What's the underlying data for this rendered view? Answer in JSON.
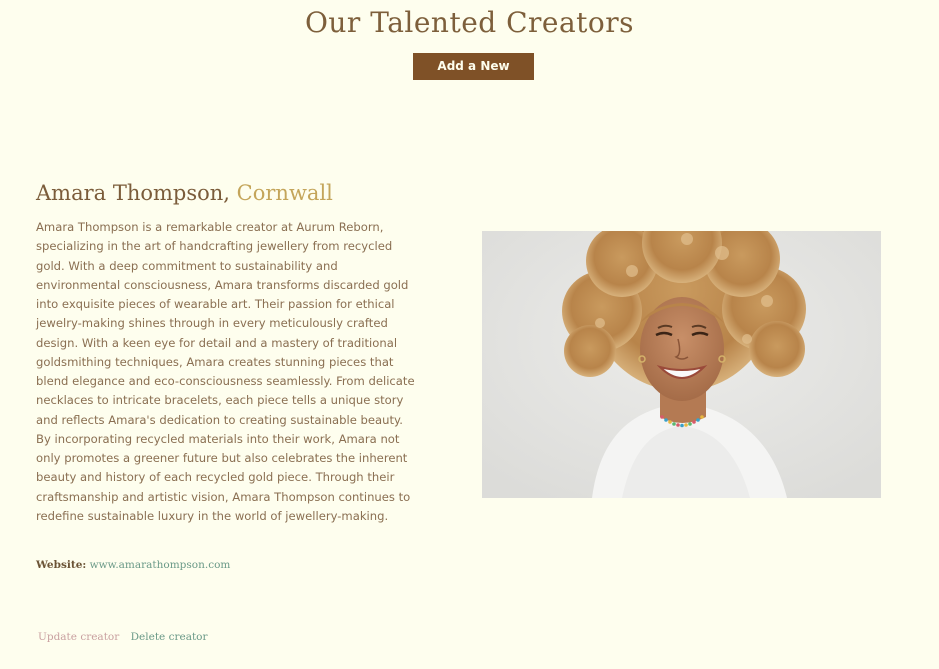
{
  "page": {
    "title": "Our Talented Creators",
    "add_button_label": "Add a New Creator"
  },
  "creator": {
    "name": "Amara Thompson,",
    "location": "Cornwall",
    "bio": "Amara Thompson is a remarkable creator at Aurum Reborn, specializing in the art of handcrafting jewellery from recycled gold. With a deep commitment to sustainability and environmental consciousness, Amara transforms discarded gold into exquisite pieces of wearable art. Their passion for ethical jewelry-making shines through in every meticulously crafted design. With a keen eye for detail and a mastery of traditional goldsmithing techniques, Amara creates stunning pieces that blend elegance and eco-consciousness seamlessly. From delicate necklaces to intricate bracelets, each piece tells a unique story and reflects Amara's dedication to creating sustainable beauty. By incorporating recycled materials into their work, Amara not only promotes a greener future but also celebrates the inherent beauty and history of each recycled gold piece. Through their craftsmanship and artistic vision, Amara Thompson continues to redefine sustainable luxury in the world of jewellery-making.",
    "website_label": "Website:",
    "website_url": "www.amarathompson.com"
  },
  "actions": {
    "update_label": "Update creator",
    "delete_label": "Delete creator"
  },
  "colors": {
    "background": "#fefeee",
    "brand_brown": "#7f5127",
    "location_gold": "#c4a55a",
    "link_green": "#6b9a88",
    "update_pink": "#c9a0a0"
  }
}
